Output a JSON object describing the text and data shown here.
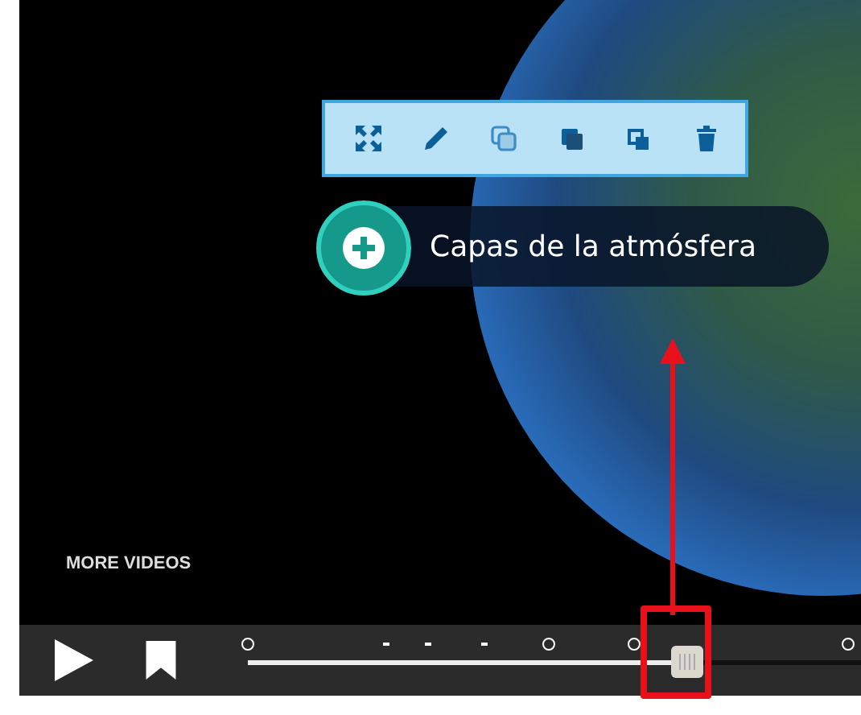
{
  "video": {
    "more_videos": "MORE VIDEOS"
  },
  "hotspot": {
    "label": "Capas de la atmósfera"
  },
  "player": {
    "progress": {
      "level": 0.7
    }
  }
}
